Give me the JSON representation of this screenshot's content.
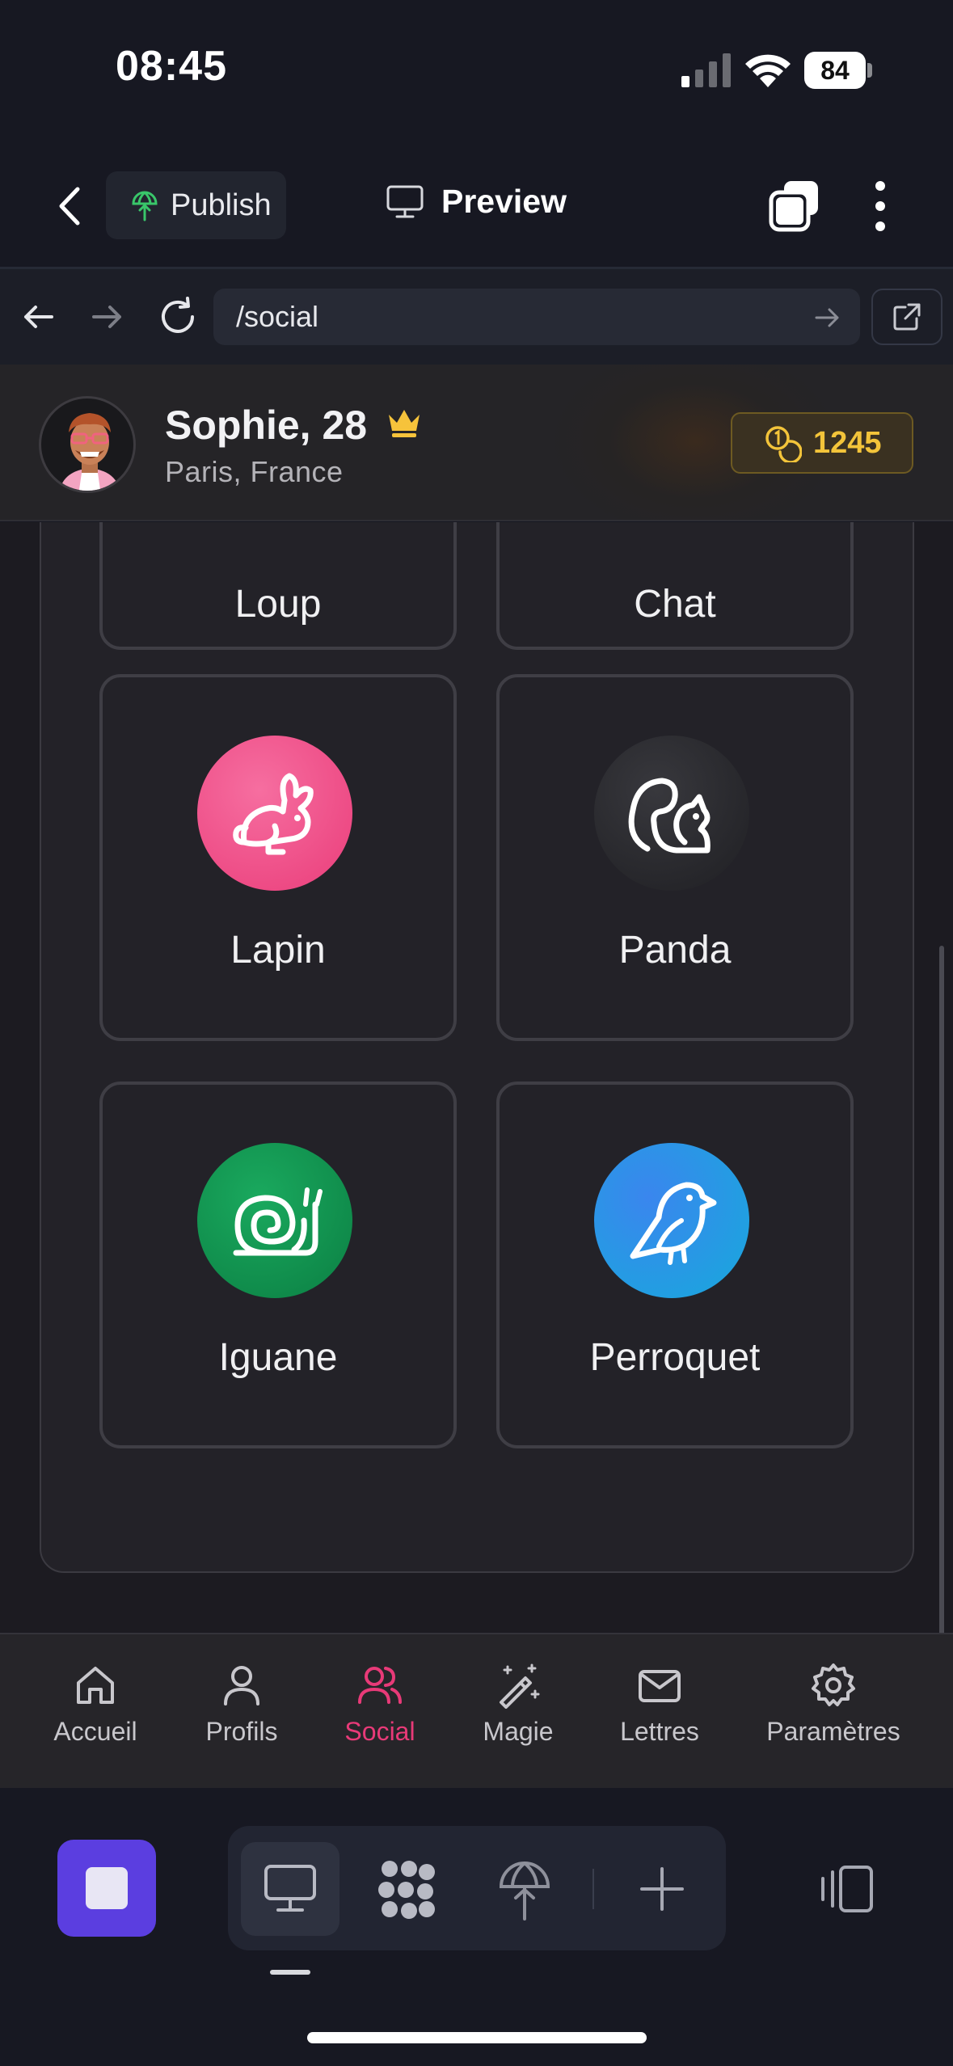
{
  "status_bar": {
    "time": "08:45",
    "battery": "84"
  },
  "toolbar": {
    "publish_label": "Publish",
    "preview_label": "Preview"
  },
  "browser": {
    "url": "/social"
  },
  "header": {
    "name": "Sophie, 28",
    "location": "Paris, France",
    "coins": "1245",
    "colors": {
      "coins": "#f3c43a",
      "crown": "#f6c33b"
    }
  },
  "grid": {
    "tiles": [
      {
        "label": "Loup"
      },
      {
        "label": "Chat"
      },
      {
        "label": "Lapin",
        "icon": "rabbit-icon",
        "color": "#f0528e"
      },
      {
        "label": "Panda",
        "icon": "squirrel-icon",
        "color": "#2a2a2e"
      },
      {
        "label": "Iguane",
        "icon": "snail-icon",
        "color": "#139a53"
      },
      {
        "label": "Perroquet",
        "icon": "bird-icon",
        "color": "#1f8ee8"
      }
    ]
  },
  "tabs": [
    {
      "label": "Accueil",
      "icon": "home-icon"
    },
    {
      "label": "Profils",
      "icon": "user-icon"
    },
    {
      "label": "Social",
      "icon": "users-icon",
      "active": true
    },
    {
      "label": "Magie",
      "icon": "magic-wand-icon"
    },
    {
      "label": "Lettres",
      "icon": "mail-icon"
    },
    {
      "label": "Paramètres",
      "icon": "gear-icon"
    }
  ],
  "accent": "#e83a78"
}
